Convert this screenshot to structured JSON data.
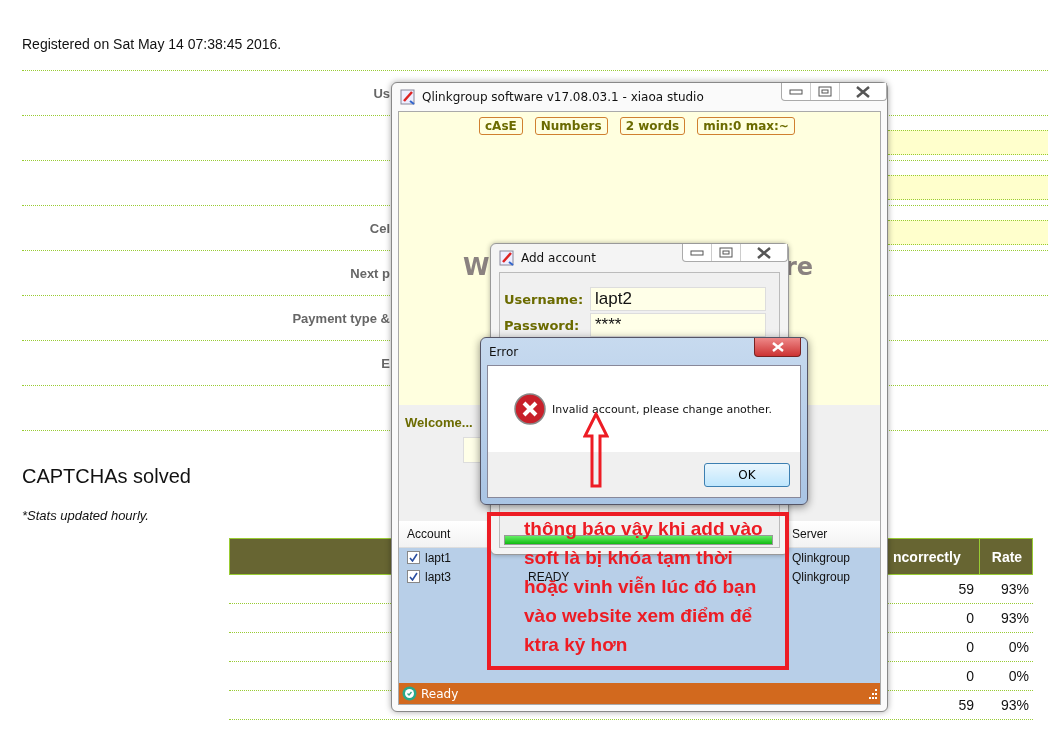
{
  "page": {
    "registered": "Registered on Sat May 14 07:38:45 2016.",
    "form_rows": [
      {
        "label": "Us",
        "kind": "text"
      },
      {
        "kind": "field"
      },
      {
        "kind": "field"
      },
      {
        "label": "Cel",
        "kind": "field"
      },
      {
        "label": "Next p",
        "kind": "text"
      },
      {
        "label": "Payment type &",
        "kind": "text"
      },
      {
        "label": "E",
        "kind": "text"
      },
      {
        "kind": "text"
      }
    ],
    "section_title": "CAPTCHAs solved",
    "note": "*Stats updated hourly.",
    "table": {
      "columns": [
        "ncorrectly",
        "Rate"
      ],
      "rows": [
        [
          "59",
          "93%"
        ],
        [
          "0",
          "93%"
        ],
        [
          "0",
          "0%"
        ],
        [
          "0",
          "0%"
        ],
        [
          "59",
          "93%"
        ]
      ]
    }
  },
  "main_window": {
    "title": "Qlinkgroup software v17.08.03.1 - xiaoa studio",
    "badges": [
      "cAsE",
      "Numbers",
      "2 words",
      "min:0 max:~"
    ],
    "banner_parts": [
      "W",
      "re"
    ],
    "welcome": "Welcome...",
    "list": {
      "columns": [
        "Account",
        "Server"
      ],
      "rows": [
        {
          "account": "lapt1",
          "checked": true,
          "server": "Qlinkgroup"
        },
        {
          "account": "lapt3",
          "checked": true,
          "status": "READY",
          "server": "Qlinkgroup"
        }
      ]
    },
    "status": "Ready"
  },
  "add_account": {
    "title": "Add account",
    "fields": [
      {
        "label": "Username:",
        "value": "lapt2"
      },
      {
        "label": "Password:",
        "value": "****"
      }
    ],
    "progress": {
      "level": 1
    }
  },
  "error_dialog": {
    "title": "Error",
    "message": "Invalid account, please change another.",
    "button": "OK"
  },
  "annotation": {
    "lines": [
      "thông báo vậy khi add vào",
      "soft là bị khóa tạm thời",
      "hoặc vỉnh viễn lúc đó bạn",
      "vào website xem điểm để",
      "ktra kỷ hơn"
    ]
  }
}
